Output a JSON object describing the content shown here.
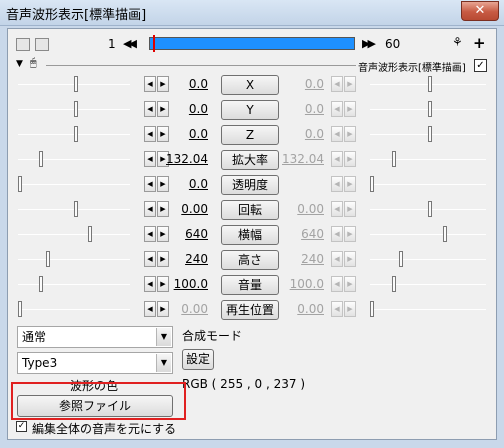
{
  "window": {
    "title": "音声波形表示[標準描画]",
    "close_glyph": "✕"
  },
  "toolbar": {
    "frame_start": "1",
    "frame_end": "60",
    "prev_glyph": "◀◀",
    "next_glyph": "▶▶",
    "filter_label": "音声波形表示[標準描画]",
    "filter_checked": "✓",
    "expand_glyph": "▼",
    "mouse_glyph": "🖱",
    "scissors_glyph": "⚘",
    "plus_glyph": "+"
  },
  "spin": {
    "left": "◀",
    "right": "▶"
  },
  "params": [
    {
      "name": "X",
      "value": "0.0",
      "end_value": "0.0",
      "enabled_end": false,
      "slider_start": 0.53,
      "slider_end": 0.53
    },
    {
      "name": "Y",
      "value": "0.0",
      "end_value": "0.0",
      "enabled_end": false,
      "slider_start": 0.53,
      "slider_end": 0.53
    },
    {
      "name": "Z",
      "value": "0.0",
      "end_value": "0.0",
      "enabled_end": false,
      "slider_start": 0.53,
      "slider_end": 0.53
    },
    {
      "name": "拡大率",
      "value": "132.04",
      "end_value": "132.04",
      "enabled_end": false,
      "slider_start": 0.2,
      "slider_end": 0.2
    },
    {
      "name": "透明度",
      "value": "0.0",
      "end_value": "",
      "enabled_end": false,
      "slider_start": 0.0,
      "slider_end": 0.0
    },
    {
      "name": "回転",
      "value": "0.00",
      "end_value": "0.00",
      "enabled_end": false,
      "slider_start": 0.53,
      "slider_end": 0.53
    },
    {
      "name": "横幅",
      "value": "640",
      "end_value": "640",
      "enabled_end": false,
      "slider_start": 0.66,
      "slider_end": 0.66
    },
    {
      "name": "高さ",
      "value": "240",
      "end_value": "240",
      "enabled_end": false,
      "slider_start": 0.26,
      "slider_end": 0.26
    },
    {
      "name": "音量",
      "value": "100.0",
      "end_value": "100.0",
      "enabled_end": false,
      "slider_start": 0.2,
      "slider_end": 0.2
    },
    {
      "name": "再生位置",
      "value": "0.00",
      "end_value": "0.00",
      "enabled_end": false,
      "slider_start": 0.0,
      "slider_end": 0.0,
      "start_disabled": true
    }
  ],
  "blend": {
    "combo_value": "通常",
    "label": "合成モード"
  },
  "type": {
    "combo_value": "Type3",
    "settings_button": "設定"
  },
  "color": {
    "label": "波形の色",
    "value": "RGB ( 255 , 0 , 237 )"
  },
  "reference": {
    "button_label": "参照ファイル"
  },
  "option": {
    "label": "編集全体の音声を元にする",
    "checked": "✓"
  }
}
